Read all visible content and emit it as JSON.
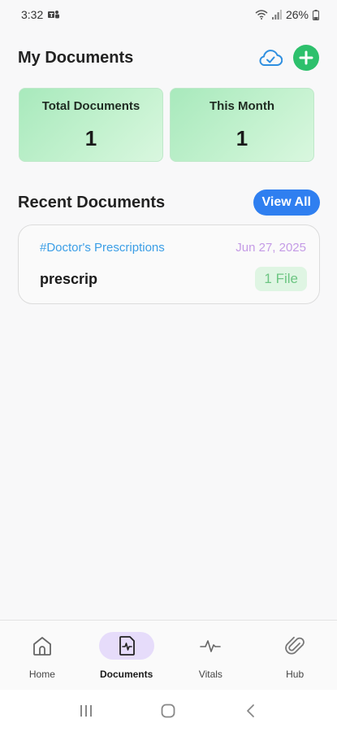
{
  "status_bar": {
    "time": "3:32",
    "battery": "26%",
    "icons": [
      "teams-icon",
      "wifi-icon",
      "signal-icon",
      "battery-icon"
    ]
  },
  "header": {
    "title": "My Documents",
    "actions": [
      "cloud-upload-icon",
      "add-icon"
    ]
  },
  "stats": [
    {
      "label": "Total Documents",
      "value": "1"
    },
    {
      "label": "This Month",
      "value": "1"
    }
  ],
  "recent": {
    "title": "Recent Documents",
    "view_all_label": "View All",
    "documents": [
      {
        "category": "#Doctor's Prescriptions",
        "date": "Jun 27, 2025",
        "name": "prescrip",
        "files": "1 File"
      }
    ]
  },
  "bottom_nav": {
    "items": [
      {
        "label": "Home",
        "icon": "home-icon",
        "active": false
      },
      {
        "label": "Documents",
        "icon": "document-icon",
        "active": true
      },
      {
        "label": "Vitals",
        "icon": "pulse-icon",
        "active": false
      },
      {
        "label": "Hub",
        "icon": "paperclip-icon",
        "active": false
      }
    ]
  },
  "system_nav": [
    "recents-icon",
    "home-circle-icon",
    "back-icon"
  ],
  "colors": {
    "accent_blue": "#2f7ff0",
    "accent_green": "#2dc06c",
    "category_blue": "#3b9ee6",
    "date_purple": "#c49be6",
    "active_tab_bg": "#e6dcfa"
  }
}
